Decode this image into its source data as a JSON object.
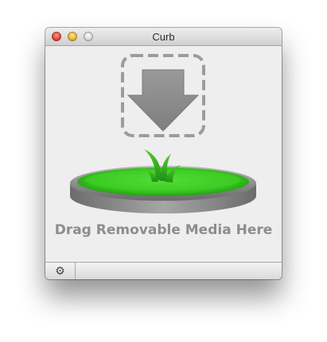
{
  "window": {
    "title": "Curb"
  },
  "traffic_lights": {
    "close": "close-button",
    "minimize": "minimize-button",
    "zoom": "zoom-button"
  },
  "drop_area": {
    "label": "Drag Removable Media Here",
    "icon": "download-arrow-icon",
    "pad_icon": "grass-platform-icon",
    "pad_color": "#35c81f"
  },
  "bottom_bar": {
    "gear_glyph": "⚙",
    "gear_icon": "gear-icon"
  }
}
